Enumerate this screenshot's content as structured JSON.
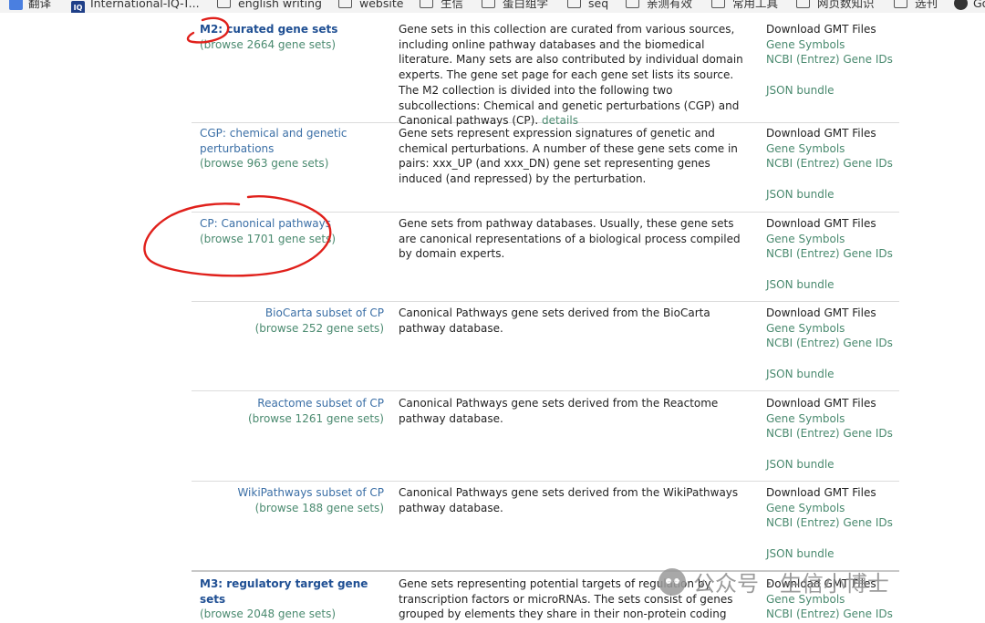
{
  "bookmarks": [
    {
      "label": "翻译",
      "icon": "translate-icon"
    },
    {
      "label": "International-IQ-T...",
      "icon": "iq-icon"
    },
    {
      "label": "english writing",
      "icon": "folder-icon"
    },
    {
      "label": "website",
      "icon": "folder-icon"
    },
    {
      "label": "生信",
      "icon": "folder-icon"
    },
    {
      "label": "蛋白组学",
      "icon": "folder-icon"
    },
    {
      "label": "seq",
      "icon": "folder-icon"
    },
    {
      "label": "亲测有效",
      "icon": "folder-icon"
    },
    {
      "label": "常用工具",
      "icon": "folder-icon"
    },
    {
      "label": "网页数知识",
      "icon": "folder-icon"
    },
    {
      "label": "选刊",
      "icon": "folder-icon"
    },
    {
      "label": "Go",
      "icon": "globe-icon"
    }
  ],
  "rows": [
    {
      "name": "M2: curated gene sets",
      "browse": "(browse 2664 gene sets)",
      "desc": "Gene sets in this collection are curated from various sources, including online pathway databases and the biomedical literature. Many sets are also contributed by individual domain experts. The gene set page for each gene set lists its source. The M2 collection is divided into the following two subcollections: Chemical and genetic perturbations (CGP) and Canonical pathways (CP).",
      "desc_link": "details"
    },
    {
      "name": "CGP: chemical and genetic perturbations",
      "browse": "(browse 963 gene sets)",
      "desc": "Gene sets represent expression signatures of genetic and chemical perturbations. A number of these gene sets come in pairs: xxx_UP (and xxx_DN) gene set representing genes induced (and repressed) by the perturbation."
    },
    {
      "name": "CP: Canonical pathways",
      "browse": "(browse 1701 gene sets)",
      "desc": "Gene sets from pathway databases. Usually, these gene sets are canonical representations of a biological process compiled by domain experts."
    },
    {
      "name": "BioCarta subset of CP",
      "browse": "(browse 252 gene sets)",
      "desc": "Canonical Pathways gene sets derived from the BioCarta pathway database."
    },
    {
      "name": "Reactome subset of CP",
      "browse": "(browse 1261 gene sets)",
      "desc": "Canonical Pathways gene sets derived from the Reactome pathway database."
    },
    {
      "name": "WikiPathways subset of CP",
      "browse": "(browse 188 gene sets)",
      "desc": "Canonical Pathways gene sets derived from the WikiPathways pathway database."
    },
    {
      "name": "M3: regulatory target gene sets",
      "browse": "(browse 2048 gene sets)",
      "desc": "Gene sets representing potential targets of regulation by transcription factors or microRNAs. The sets consist of genes grouped by elements they share in their non-protein coding"
    }
  ],
  "downloads": {
    "title": "Download GMT Files",
    "symbols": "Gene Symbols",
    "entrez": "NCBI (Entrez) Gene IDs",
    "json": "JSON bundle"
  },
  "watermark": "公众号 · 生信小博士",
  "colors": {
    "link": "#3b6fa6",
    "link_green": "#4a8a6f",
    "heading": "#1f4f93",
    "annotation": "#e0201b"
  }
}
